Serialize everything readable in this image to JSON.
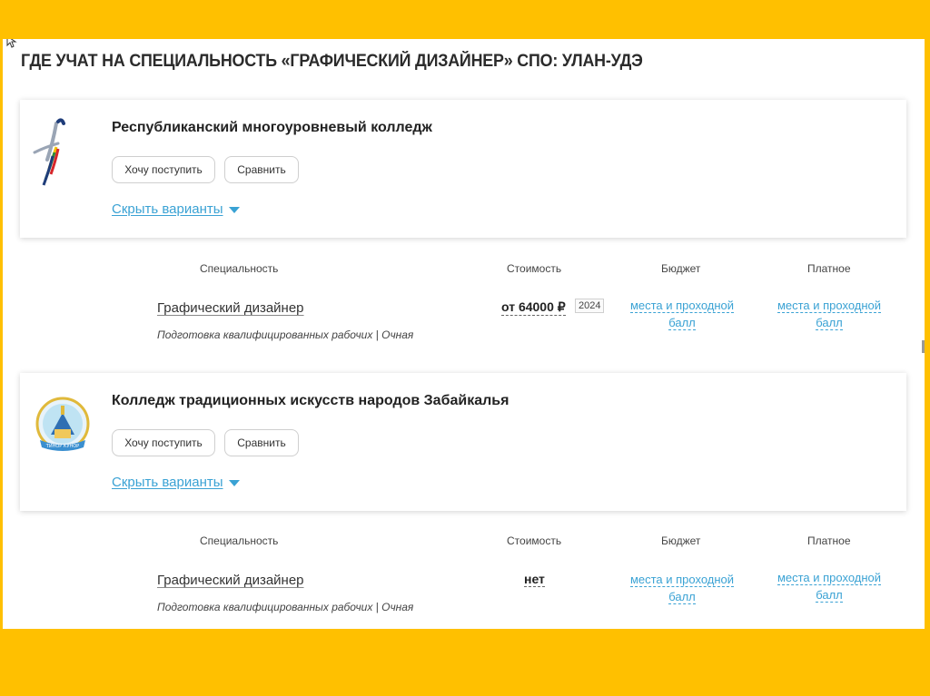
{
  "title": "ГДЕ УЧАТ НА СПЕЦИАЛЬНОСТЬ «ГРАФИЧЕСКИЙ ДИЗАЙНЕР» СПО: УЛАН-УДЭ",
  "colors": {
    "frame": "#ffc000",
    "link": "#3aa2d4"
  },
  "columns": {
    "specialty": "Специальность",
    "cost": "Стоимость",
    "budget": "Бюджет",
    "paid": "Платное"
  },
  "colleges": [
    {
      "name": "Республиканский многоуровневый колледж",
      "logo": "runner-figure-logo",
      "apply_label": "Хочу поступить",
      "compare_label": "Сравнить",
      "toggle_label": "Скрыть варианты",
      "program": {
        "specialty": "Графический дизайнер",
        "details": "Подготовка квалифицированных рабочих | Очная",
        "cost": "от 64000 ₽",
        "year": "2024",
        "budget_line1": "места и проходной",
        "budget_line2": "балл",
        "paid_line1": "места и проходной",
        "paid_line2": "балл"
      }
    },
    {
      "name": "Колледж традиционных искусств народов Забайкалья",
      "logo": "temple-emblem-logo",
      "apply_label": "Хочу поступить",
      "compare_label": "Сравнить",
      "toggle_label": "Скрыть варианты",
      "program": {
        "specialty": "Графический дизайнер",
        "details": "Подготовка квалифицированных рабочих | Очная",
        "cost": "нет",
        "budget_line1": "места и проходной",
        "budget_line2": "балл",
        "paid_line1": "места и проходной",
        "paid_line2": "балл"
      }
    }
  ]
}
